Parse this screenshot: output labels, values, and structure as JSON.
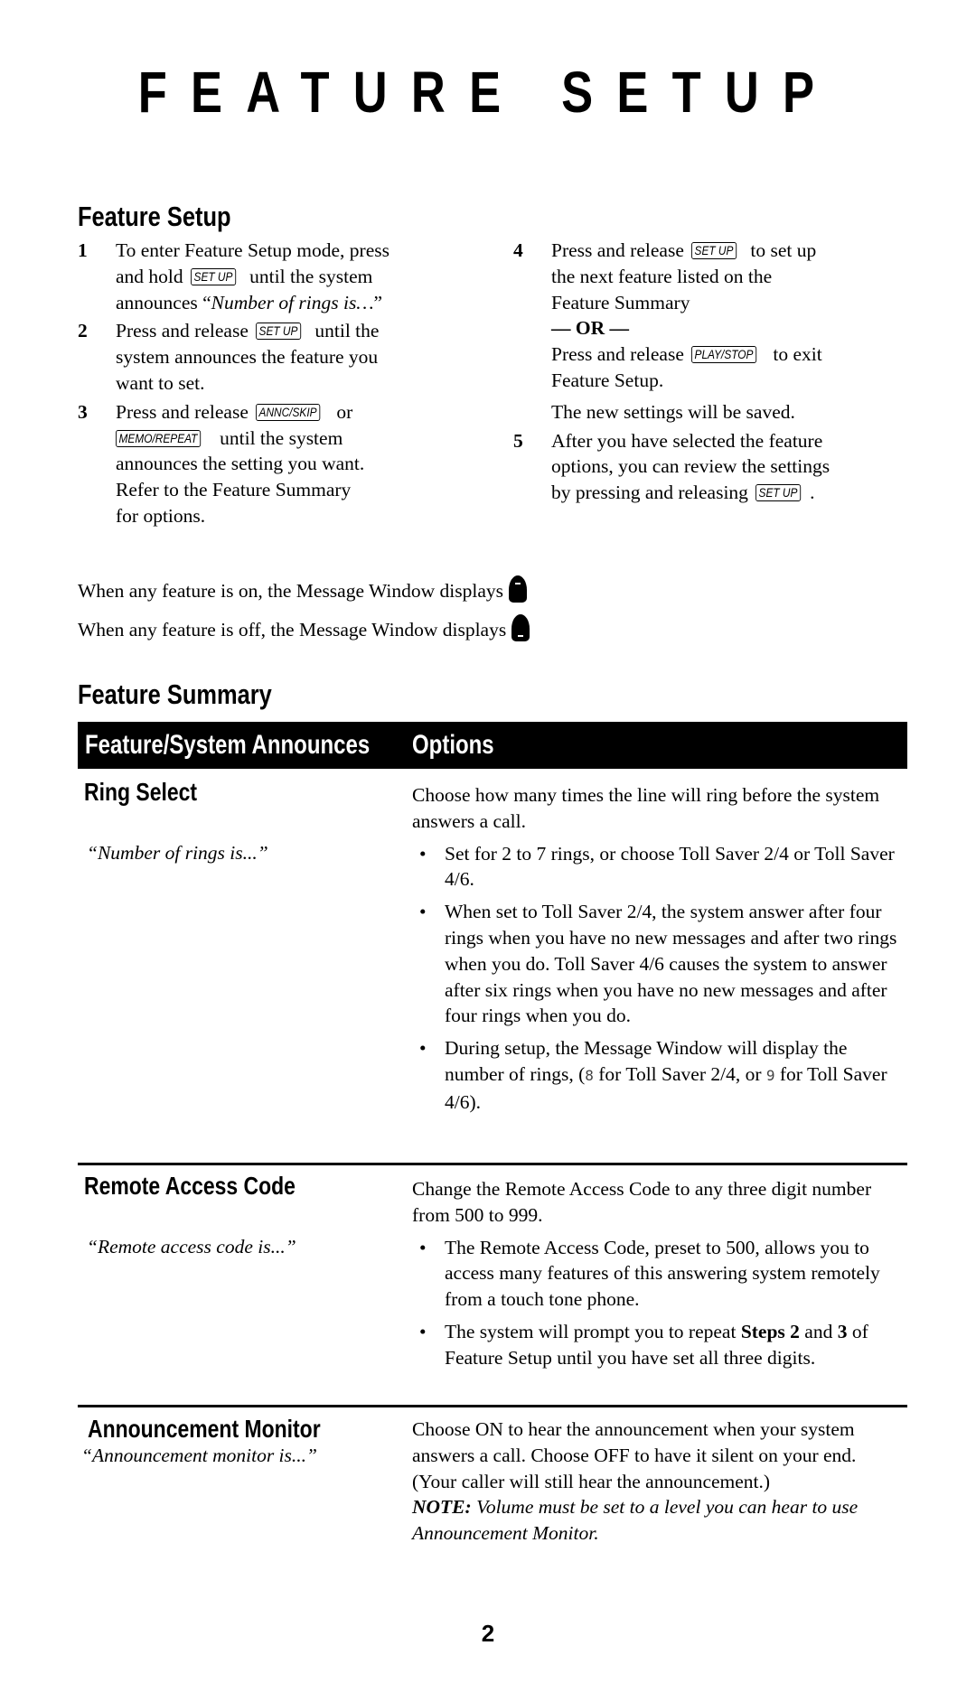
{
  "page_title": "FEATURE SETUP",
  "setup": {
    "heading": "Feature Setup",
    "steps": [
      {
        "number": "1",
        "lines": [
          {
            "pre": "To enter Feature Setup mode, press"
          },
          {
            "pre": "and hold",
            "key": "SET UP",
            "post": "until the system"
          },
          {
            "pre": "announces “",
            "italic": "Number of rings is…",
            "post": "”"
          }
        ]
      },
      {
        "number": "2",
        "lines": [
          {
            "pre": "Press and release",
            "key": "SET UP",
            "post": "until the"
          },
          {
            "pre": "system announces the feature you"
          },
          {
            "pre": "want to set."
          }
        ]
      },
      {
        "number": "3",
        "lines": [
          {
            "pre": "Press and release",
            "key": "ANNC/SKIP",
            "post": "or"
          },
          {
            "pre": "",
            "key": "MEMO/REPEAT",
            "post": "until the system"
          },
          {
            "pre": "announces the setting you want."
          },
          {
            "pre": "Refer to the Feature Summary"
          },
          {
            "pre": "for options."
          }
        ]
      },
      {
        "number": "4",
        "lines": [
          {
            "pre": "Press and release",
            "key": "SET UP",
            "post": "to set up"
          },
          {
            "pre": "the next feature listed on the"
          },
          {
            "pre": "Feature Summary"
          }
        ],
        "or_label": "— OR —",
        "alt_lines": [
          {
            "pre": "Press and release",
            "key": "PLAY/STOP",
            "post": "to exit"
          },
          {
            "pre": "Feature Setup."
          }
        ],
        "note": "The new settings will be saved."
      },
      {
        "number": "5",
        "lines": [
          {
            "pre": "After you have selected the feature"
          },
          {
            "pre": "options, you can review the settings"
          },
          {
            "pre": "by pressing and releasing",
            "key": "SET UP",
            "post": "."
          }
        ]
      }
    ]
  },
  "message_window": {
    "on_text": "When any feature is on, the Message Window displays",
    "on_icon": "feature-on-indicator-icon",
    "off_text": "When any feature is off, the Message Window displays",
    "off_icon": "feature-off-indicator-icon"
  },
  "summary": {
    "heading": "Feature Summary",
    "columns": [
      "Feature/System Announces",
      "Options"
    ],
    "rows": [
      {
        "feature": "Ring Select",
        "announces": "“Number of rings is...”",
        "intro": "Choose how many times the line will ring before the system answers a call.",
        "bullets": [
          "Set for 2 to 7 rings, or choose Toll Saver 2/4 or Toll Saver 4/6.",
          "When set to Toll Saver 2/4, the system answer after four rings when you have no new messages and after two rings when you do. Toll Saver 4/6 causes the system to answer after six rings when you have no new messages and after four rings when you do."
        ],
        "display_bullet": {
          "pre": "During setup, the Message Window will display the number of rings, (",
          "lcd_a": "8",
          "mid": " for Toll Saver 2/4, or ",
          "lcd_b": "9",
          "post": " for Toll Saver 4/6)."
        }
      },
      {
        "feature": "Remote Access Code",
        "announces": "“Remote access code is...”",
        "intro": "Change the Remote Access Code to any three digit number from 500 to 999.",
        "bullets": [
          "The Remote Access Code, preset to 500, allows you to access many features of this answering system remotely from a touch tone phone."
        ],
        "steps_bullet": {
          "pre": "The system will prompt you to repeat ",
          "bold_a": "Steps 2",
          "mid": " and ",
          "bold_b": "3",
          "post": " of Feature Setup until you have set all three digits."
        }
      },
      {
        "feature": "Announcement Monitor",
        "announces": "“Announcement monitor is...”",
        "intro": "Choose ON to hear the announcement when your system answers a call.  Choose OFF to have it silent on your end.  (Your caller will still hear the announcement.)",
        "note_label": "NOTE:",
        "note_text": " Volume must be set to a level you can hear to use Announcement Monitor."
      }
    ]
  },
  "page_number": "2"
}
